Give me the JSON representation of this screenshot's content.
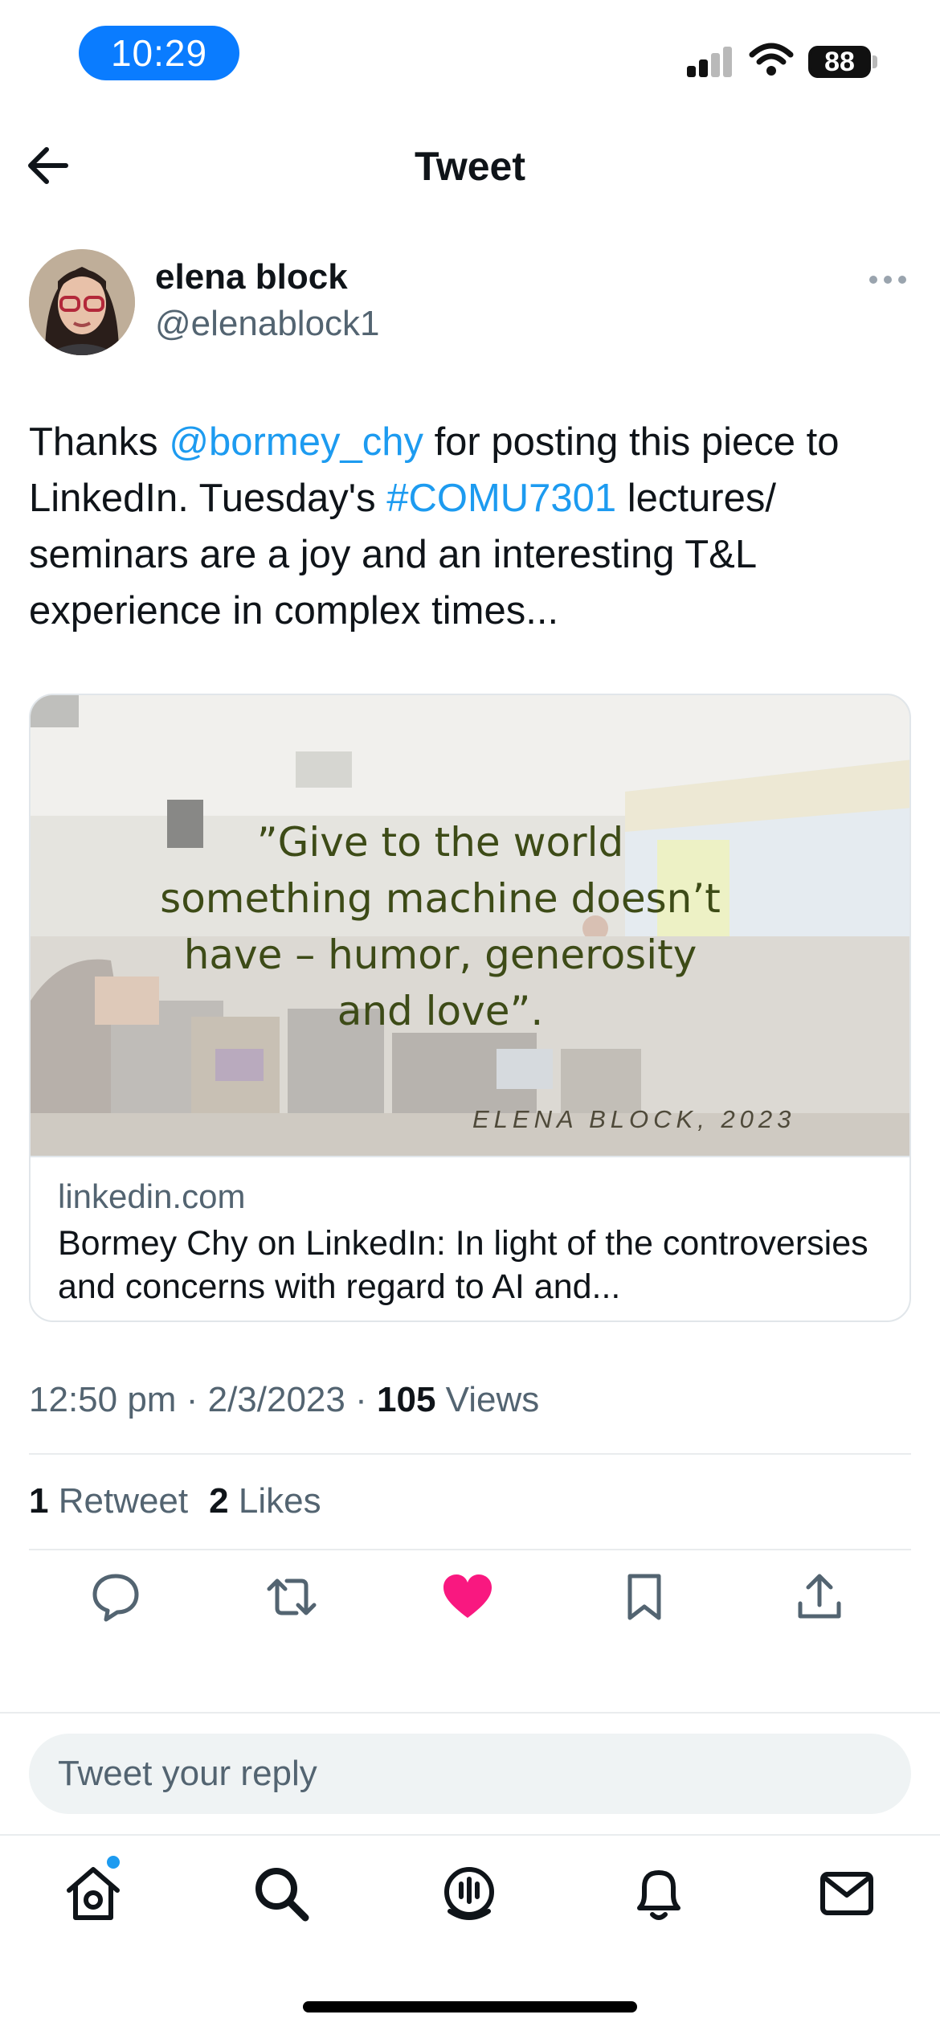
{
  "status_bar": {
    "time": "10:29",
    "battery": "88"
  },
  "header": {
    "title": "Tweet"
  },
  "author": {
    "name": "elena block",
    "handle": "@elenablock1"
  },
  "tweet": {
    "text_parts": [
      "Thanks ",
      "@bormey_chy",
      " for posting this piece to LinkedIn. Tuesday's ",
      "#COMU7301",
      " lectures/ seminars are a joy and an interesting T&L experience in complex times..."
    ],
    "mention": "@bormey_chy",
    "hashtag": "#COMU7301"
  },
  "card": {
    "quote_lines": [
      "”Give to the world",
      "something machine doesn’t",
      "have – humor, generosity",
      "and love”."
    ],
    "quote_author": "ELENA BLOCK, 2023",
    "domain": "linkedin.com",
    "title": "Bormey Chy on LinkedIn: In light of the controversies and concerns with regard to AI and..."
  },
  "meta": {
    "time": "12:50 pm",
    "date": "2/3/2023",
    "views_count": "105",
    "views_label": "Views",
    "separator": "·"
  },
  "stats": {
    "retweets_count": "1",
    "retweets_label": "Retweet",
    "likes_count": "2",
    "likes_label": "Likes"
  },
  "actions": {
    "icons": [
      "reply-icon",
      "retweet-icon",
      "like-icon",
      "bookmark-icon",
      "share-icon"
    ],
    "like_color": "#f91880"
  },
  "reply": {
    "placeholder": "Tweet your reply"
  },
  "nav": {
    "icons": [
      "home-icon",
      "search-icon",
      "spaces-icon",
      "notifications-icon",
      "messages-icon"
    ],
    "accent": "#1d9bf0"
  }
}
